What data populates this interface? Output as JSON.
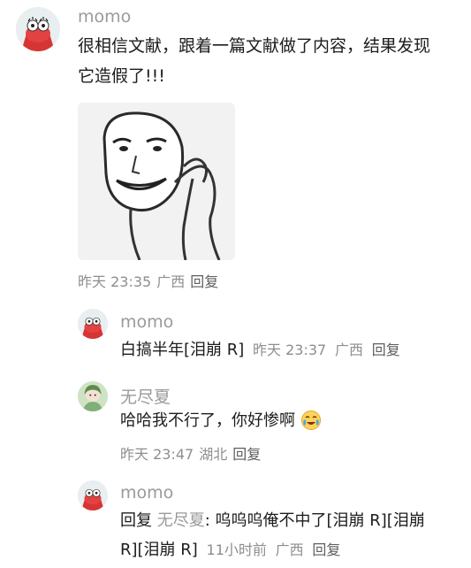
{
  "comments": [
    {
      "user": "momo",
      "text_line1": "很相信文献，跟着一篇文献做了内容，结果发现",
      "text_line2": "它造假了!!!",
      "time": "昨天 23:35",
      "location": "广西",
      "reply_label": "回复"
    }
  ],
  "replies": [
    {
      "user": "momo",
      "text": "白搞半年[泪崩 R]",
      "time": "昨天 23:37",
      "location": "广西",
      "reply_label": "回复"
    },
    {
      "user": "无尽夏",
      "text": "哈哈我不行了，你好惨啊",
      "time": "昨天 23:47",
      "location": "湖北",
      "reply_label": "回复"
    },
    {
      "user": "momo",
      "reply_prefix": "回复",
      "reply_target": "无尽夏",
      "text_line1": ": 呜呜呜俺不中了[泪崩 R][泪崩",
      "text_line2": "R][泪崩 R]",
      "time": "11小时前",
      "location": "广西",
      "reply_label": "回复"
    }
  ],
  "colors": {
    "username": "#9a9a9a",
    "body": "#1c1c1c",
    "meta": "#8e8e8e",
    "avatar_momo_bg": "#e03a3a",
    "avatar_wujinxia_bg": "#8fbf8a"
  },
  "icons": {
    "momo_avatar": "patrick-star-avatar-icon",
    "wujinxia_avatar": "anime-girl-avatar-icon",
    "meme_image": "meme-face-image",
    "crying_emoji": "crying-laughing-face-icon"
  }
}
